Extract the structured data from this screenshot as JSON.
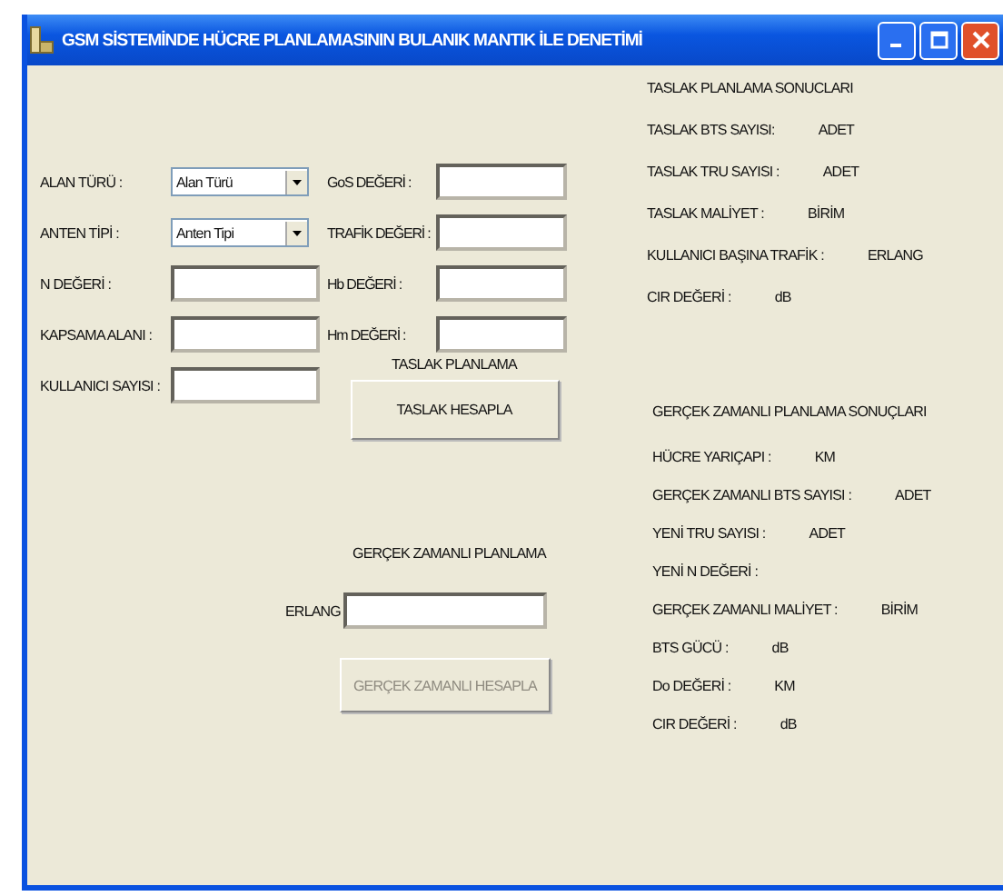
{
  "window": {
    "title": "GSM SİSTEMİNDE HÜCRE PLANLAMASININ BULANIK MANTIK İLE DENETİMİ"
  },
  "form": {
    "left": [
      {
        "label": "ALAN TÜRÜ :",
        "kind": "combo",
        "value": "Alan Türü"
      },
      {
        "label": "ANTEN TİPİ :",
        "kind": "combo",
        "value": "Anten Tipi"
      },
      {
        "label": "N DEĞERİ :",
        "kind": "text"
      },
      {
        "label": "KAPSAMA ALANI :",
        "kind": "text"
      },
      {
        "label": "KULLANICI SAYISI :",
        "kind": "text"
      }
    ],
    "right": [
      {
        "label": "GoS DEĞERİ :",
        "kind": "text"
      },
      {
        "label": "TRAFİK DEĞERİ :",
        "kind": "text"
      },
      {
        "label": "Hb DEĞERİ :",
        "kind": "text"
      },
      {
        "label": "Hm DEĞERİ :",
        "kind": "text"
      }
    ]
  },
  "draft": {
    "heading": "TASLAK PLANLAMA",
    "button": {
      "label": "TASLAK HESAPLA",
      "disabled": false
    }
  },
  "realtime": {
    "heading": "GERÇEK ZAMANLI PLANLAMA",
    "field_label": "ERLANG",
    "button": {
      "label": "GERÇEK ZAMANLI HESAPLA",
      "disabled": true
    }
  },
  "draft_results": {
    "heading": "TASLAK PLANLAMA SONUCLARI",
    "rows": [
      {
        "label": "TASLAK BTS SAYISI:",
        "unit": "ADET"
      },
      {
        "label": "TASLAK TRU SAYISI :",
        "unit": "ADET"
      },
      {
        "label": "TASLAK MALİYET :",
        "unit": "BİRİM"
      },
      {
        "label": "KULLANICI BAŞINA TRAFİK :",
        "unit": "ERLANG"
      },
      {
        "label": "CIR DEĞERİ :",
        "unit": "dB"
      }
    ]
  },
  "realtime_results": {
    "heading": "GERÇEK ZAMANLI PLANLAMA SONUÇLARI",
    "rows": [
      {
        "label": "HÜCRE YARIÇAPI :",
        "unit": "KM"
      },
      {
        "label": "GERÇEK ZAMANLI BTS SAYISI :",
        "unit": "ADET"
      },
      {
        "label": "YENİ TRU SAYISI :",
        "unit": "ADET"
      },
      {
        "label": "YENİ N DEĞERİ :"
      },
      {
        "label": "GERÇEK ZAMANLI MALİYET :",
        "unit": "BİRİM"
      },
      {
        "label": "BTS GÜCÜ :",
        "unit": "dB"
      },
      {
        "label": "Do DEĞERİ :",
        "unit": "KM"
      },
      {
        "label": "CIR DEĞERİ :",
        "unit": "dB"
      }
    ]
  }
}
